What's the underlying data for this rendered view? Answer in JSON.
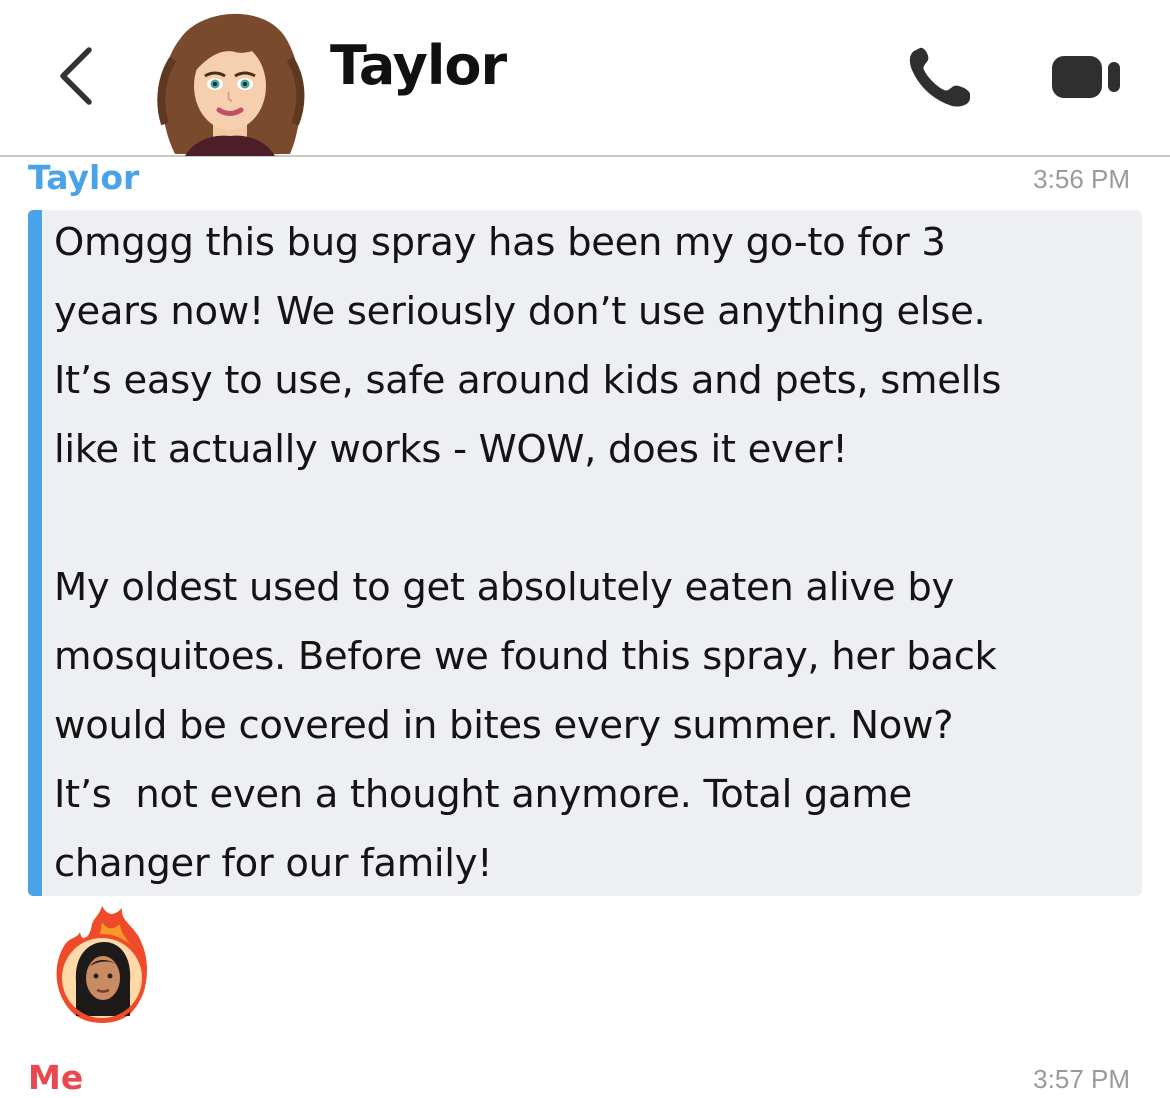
{
  "header": {
    "title": "Taylor",
    "back_icon": "chevron-left-icon",
    "call_icon": "phone-icon",
    "video_icon": "video-camera-icon"
  },
  "messages": [
    {
      "sender": "Taylor",
      "time": "3:56 PM",
      "sender_color": "#4aa3e8",
      "text": "Omggg this bug spray has been my go-to for 3\nyears now! We seriously don’t use anything else.\nIt’s easy to use, safe around kids and pets, smells\nlike it actually works - WOW, does it ever!\n\nMy oldest used to get absolutely eaten alive by\nmosquitoes. Before we found this spray, her back\nwould be covered in bites every summer. Now?\nIt’s  not even a thought anymore. Total game\nchanger for our family!",
      "reaction_icon": "fire-avatar-icon"
    },
    {
      "sender": "Me",
      "time": "3:57 PM",
      "sender_color": "#e8484e"
    }
  ]
}
